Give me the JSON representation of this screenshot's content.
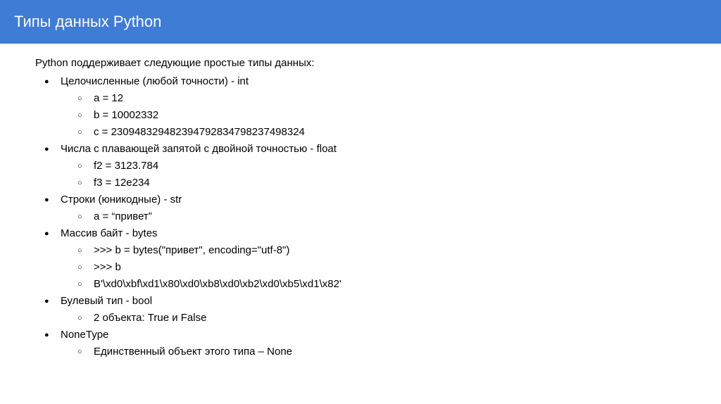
{
  "header": {
    "title": "Типы данных Python"
  },
  "intro": "Python поддерживает следующие простые типы данных:",
  "types": [
    {
      "label": "Целочисленные (любой точности) - int",
      "items": [
        "a = 12",
        "b = 10002332",
        "c = 230948329482394792834798237498324"
      ]
    },
    {
      "label": "Числа с плавающей запятой с двойной точностью - float",
      "items": [
        "f2 = 3123.784",
        "f3 = 12e234"
      ]
    },
    {
      "label": "Строки (юникодные) - str",
      "items": [
        "a = “привет”"
      ]
    },
    {
      "label": "Массив байт - bytes",
      "items": [
        ">>> b = bytes(\"привет\", encoding=\"utf-8\")",
        ">>> b",
        "B'\\xd0\\xbf\\xd1\\x80\\xd0\\xb8\\xd0\\xb2\\xd0\\xb5\\xd1\\x82'"
      ]
    },
    {
      "label": "Булевый тип - bool",
      "items": [
        "2 объекта: True и False"
      ]
    },
    {
      "label": "NoneType",
      "items": [
        "Единственный объект этого типа – None"
      ]
    }
  ]
}
